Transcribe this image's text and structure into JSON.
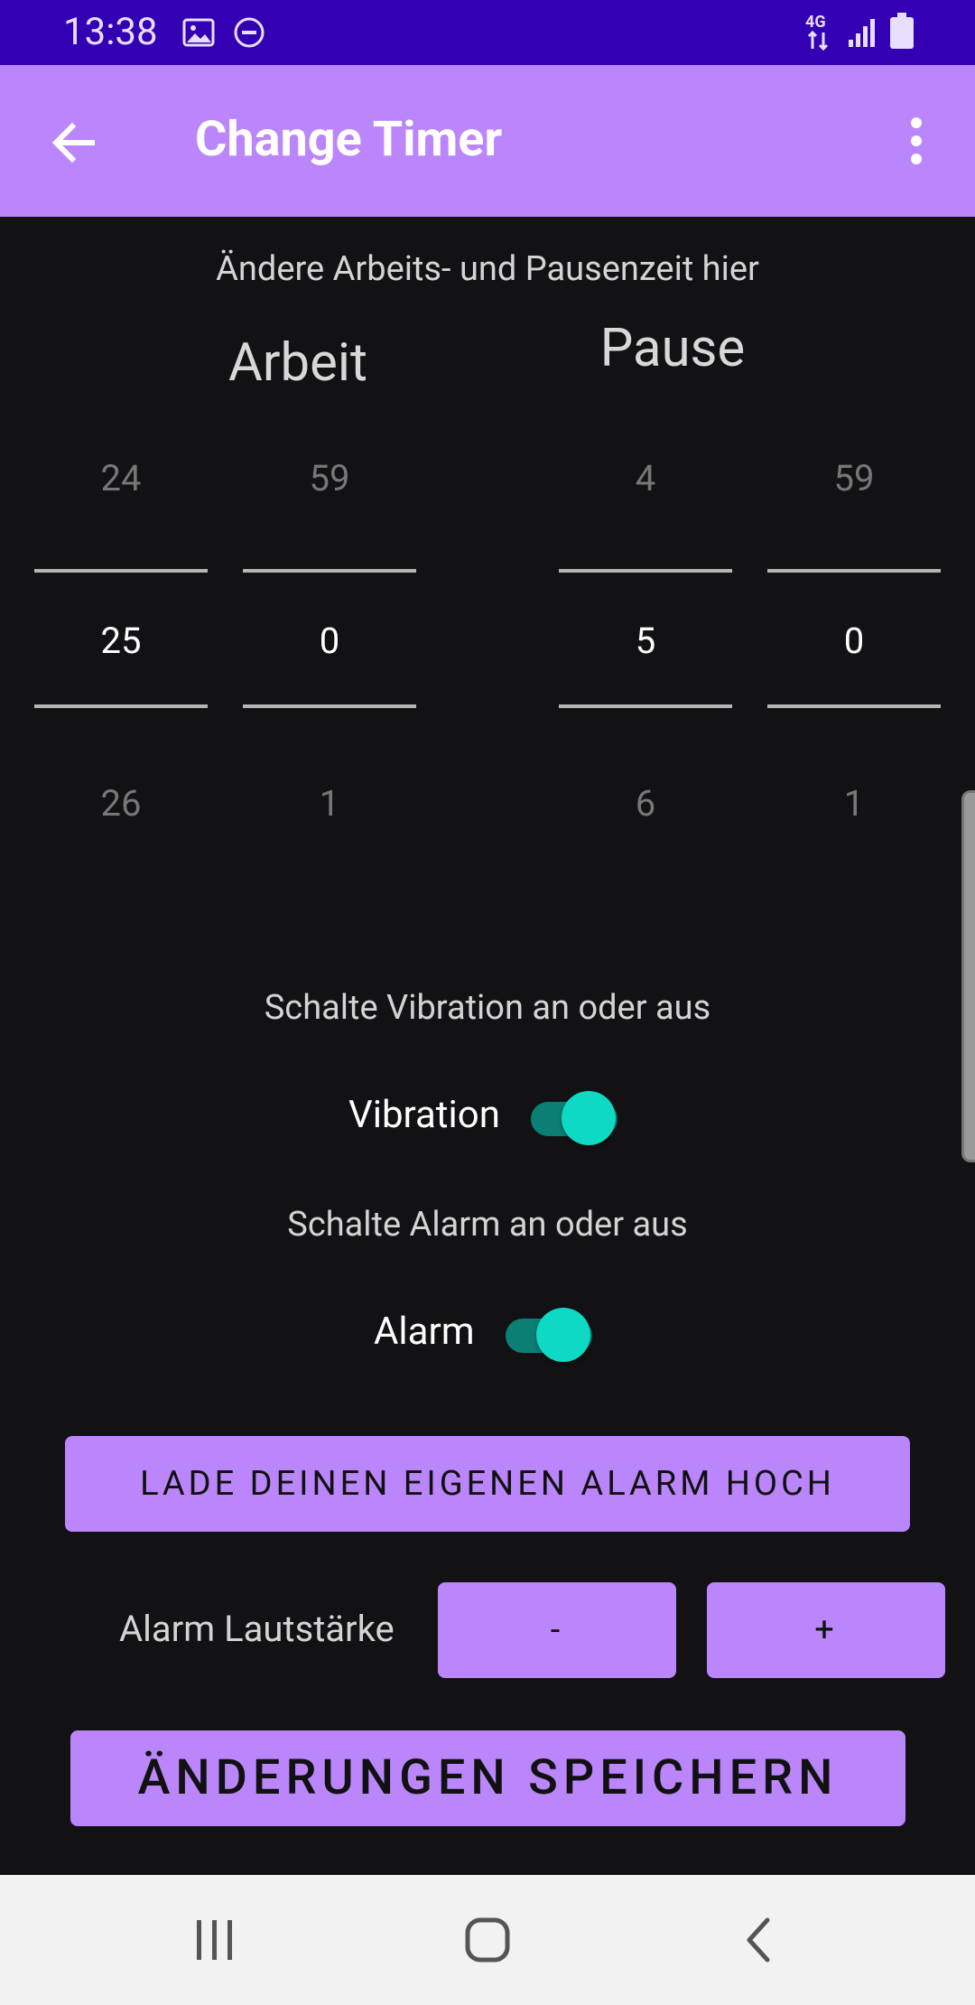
{
  "status_bar": {
    "time": "13:38",
    "icons": [
      "image-icon",
      "do-not-disturb-icon",
      "network-4g-icon",
      "signal-icon",
      "battery-icon"
    ],
    "network_label": "4G"
  },
  "app_bar": {
    "title": "Change Timer",
    "back_icon": "arrow-back-icon",
    "menu_icon": "more-vert-icon"
  },
  "timer": {
    "hint": "Ändere Arbeits- und Pausenzeit hier",
    "work": {
      "title": "Arbeit",
      "minutes": {
        "prev": "24",
        "current": "25",
        "next": "26"
      },
      "seconds": {
        "prev": "59",
        "current": "0",
        "next": "1"
      }
    },
    "pause": {
      "title": "Pause",
      "minutes": {
        "prev": "4",
        "current": "5",
        "next": "6"
      },
      "seconds": {
        "prev": "59",
        "current": "0",
        "next": "1"
      }
    }
  },
  "vibration": {
    "hint": "Schalte Vibration an oder aus",
    "label": "Vibration",
    "enabled": true
  },
  "alarm": {
    "hint": "Schalte Alarm an oder aus",
    "label": "Alarm",
    "enabled": true,
    "upload_label": "LADE DEINEN EIGENEN ALARM HOCH",
    "volume_label": "Alarm Lautstärke",
    "minus_label": "-",
    "plus_label": "+"
  },
  "save_label": "ÄNDERUNGEN SPEICHERN",
  "nav_bar": {
    "icons": [
      "recents-icon",
      "home-icon",
      "back-icon"
    ]
  },
  "colors": {
    "status_bar": "#3400b4",
    "accent": "#bb86fc",
    "switch_track": "#0b7f74",
    "switch_thumb": "#0dd9c4",
    "background": "#121214"
  }
}
